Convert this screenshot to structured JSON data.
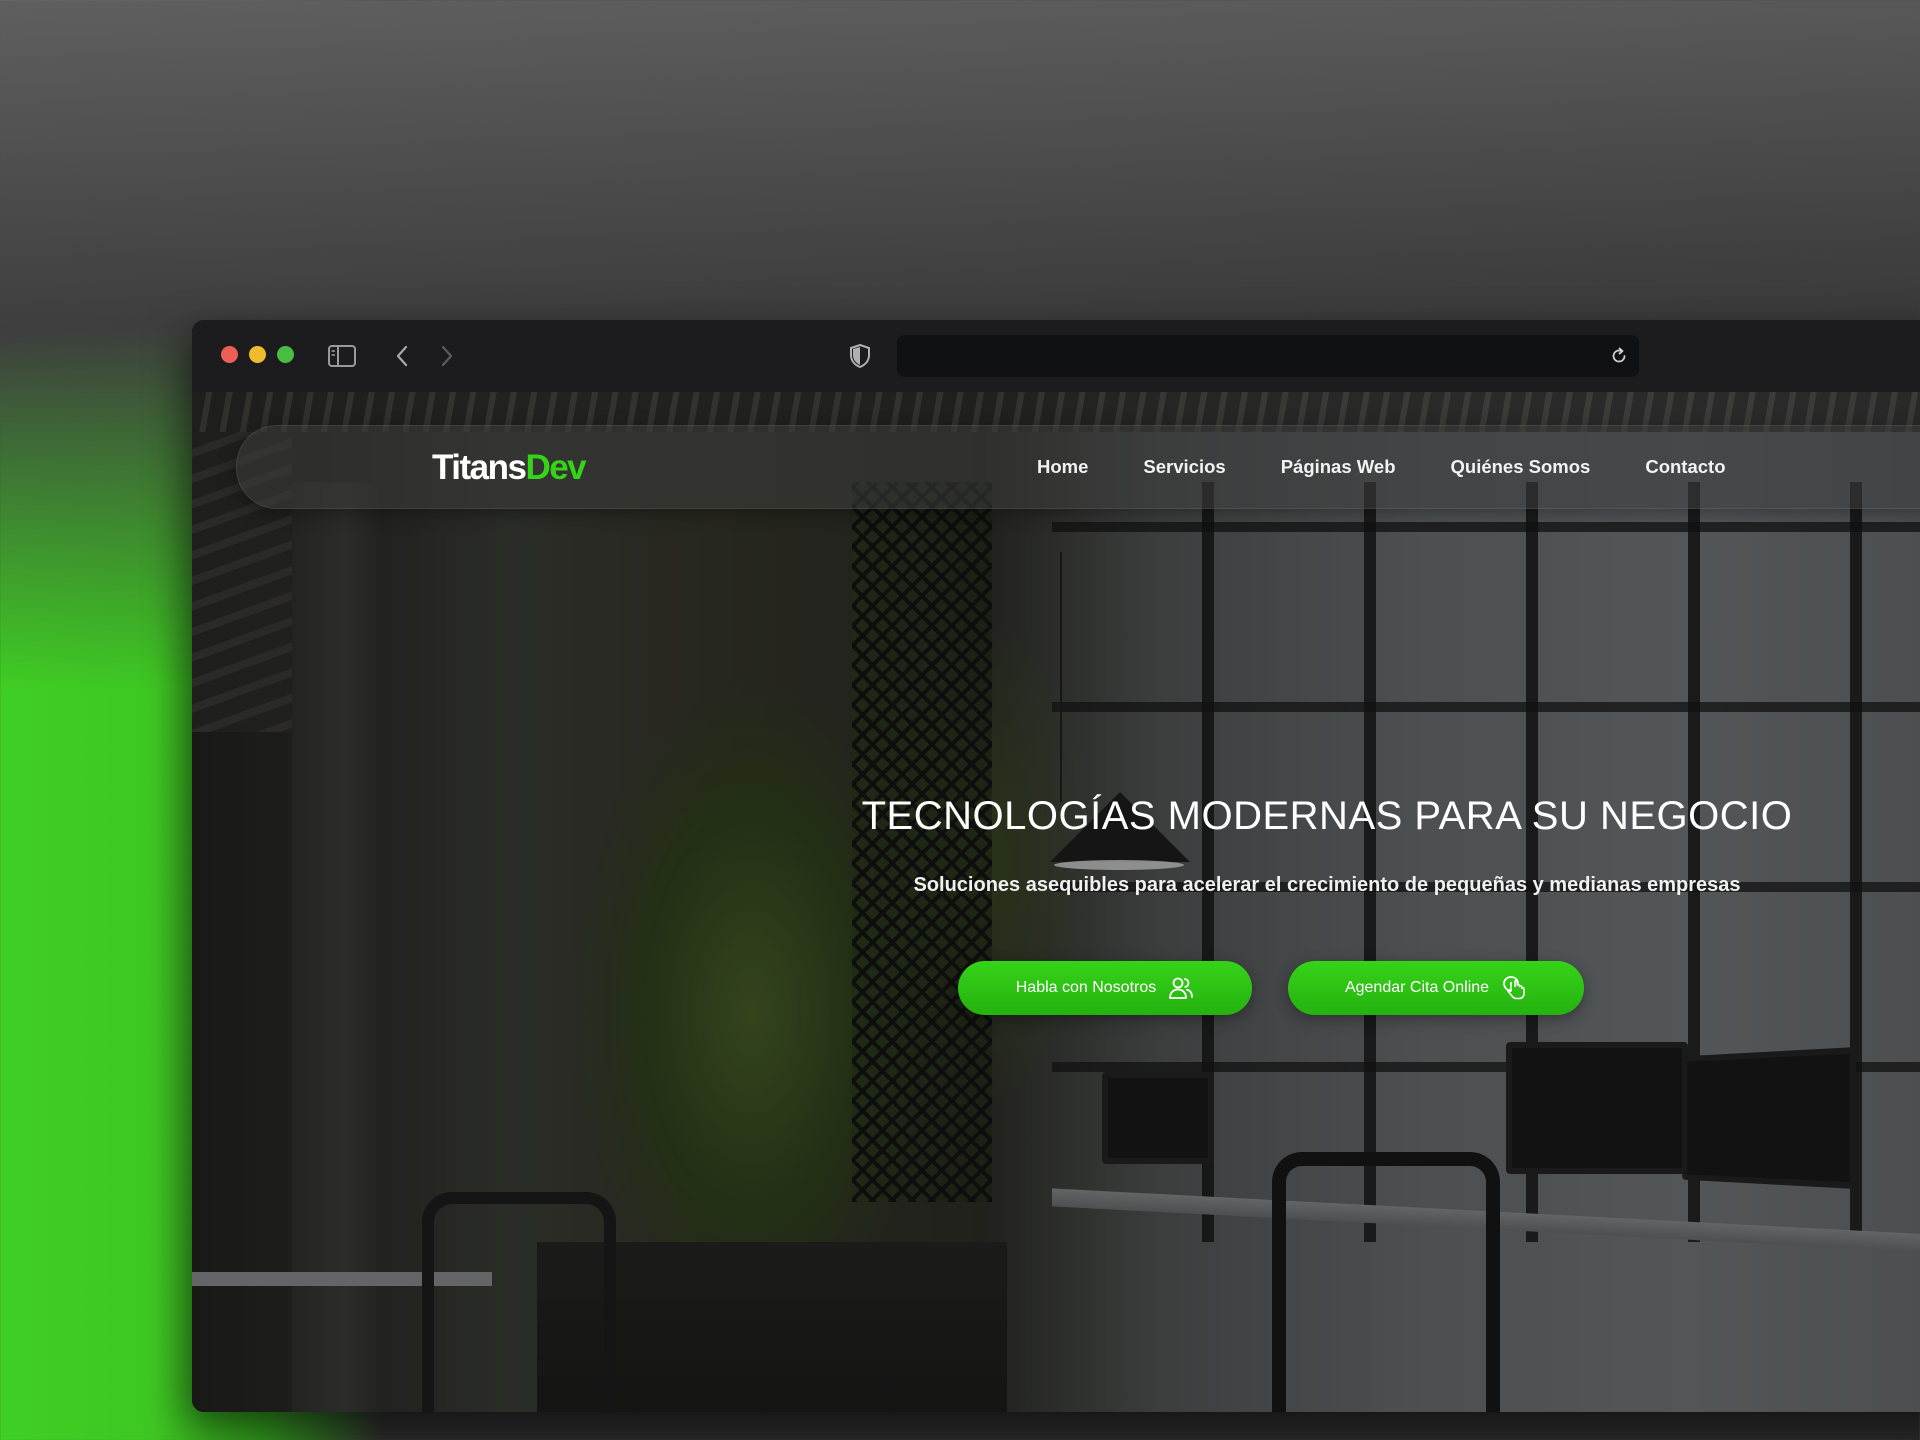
{
  "browser": {
    "url_text": "",
    "icons": {
      "sidebar": "sidebar-icon",
      "back": "chevron-left-icon",
      "forward": "chevron-right-icon",
      "shield": "shield-icon",
      "reload": "reload-icon"
    }
  },
  "site": {
    "logo": {
      "part1": "Titans",
      "part2": "Dev"
    },
    "nav": [
      {
        "label": "Home"
      },
      {
        "label": "Servicios"
      },
      {
        "label": "Páginas Web"
      },
      {
        "label": "Quiénes Somos"
      },
      {
        "label": "Contacto"
      }
    ],
    "hero": {
      "title": "TECNOLOGÍAS MODERNAS PARA SU NEGOCIO",
      "subtitle": "Soluciones asequibles para acelerar el crecimiento de pequeñas y medianas empresas",
      "buttons": [
        {
          "label": "Habla con Nosotros",
          "icon": "users-icon"
        },
        {
          "label": "Agendar Cita Online",
          "icon": "calendar-tap-icon"
        }
      ]
    },
    "colors": {
      "accent": "#36d418",
      "button": "#2bc214",
      "background_green": "#3fcf24"
    }
  }
}
